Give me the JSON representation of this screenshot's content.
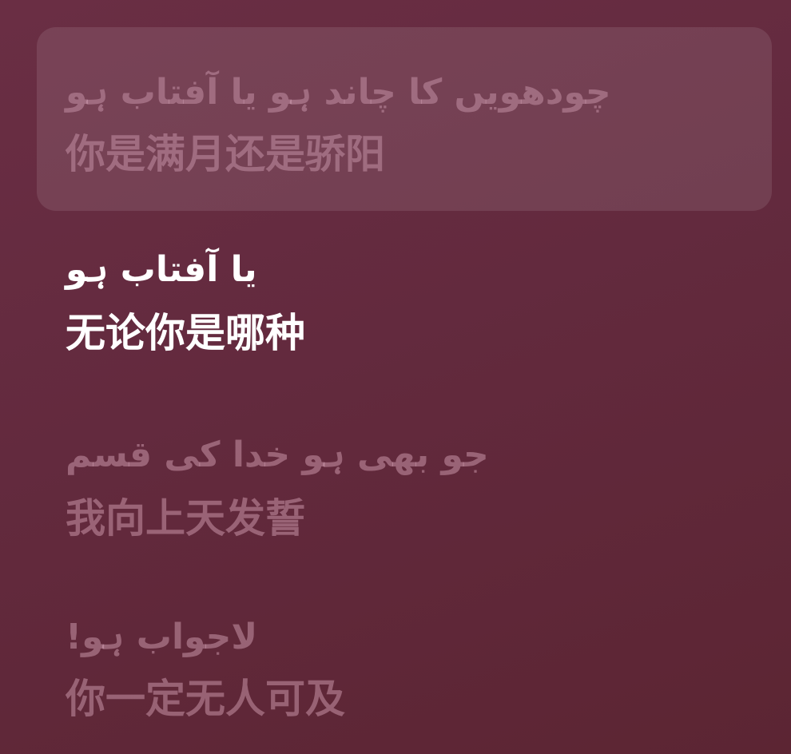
{
  "lyrics": {
    "previous": {
      "original": "چودھویں کا چاند ہو یا آفتاب ہو",
      "translation": "你是满月还是骄阳"
    },
    "active": {
      "original": "یا آفتاب ہو",
      "translation": "无论你是哪种"
    },
    "upcoming": [
      {
        "original": "جو بھی ہو خدا کی قسم",
        "translation": "我向上天发誓"
      },
      {
        "original": "لاجواب ہو!",
        "translation": "你一定无人可及"
      }
    ]
  },
  "colors": {
    "background": "#632a3e",
    "active_text": "#ffffff",
    "dim_text": "#d9a6b8",
    "card_highlight": "rgba(255,255,255,0.10)"
  }
}
